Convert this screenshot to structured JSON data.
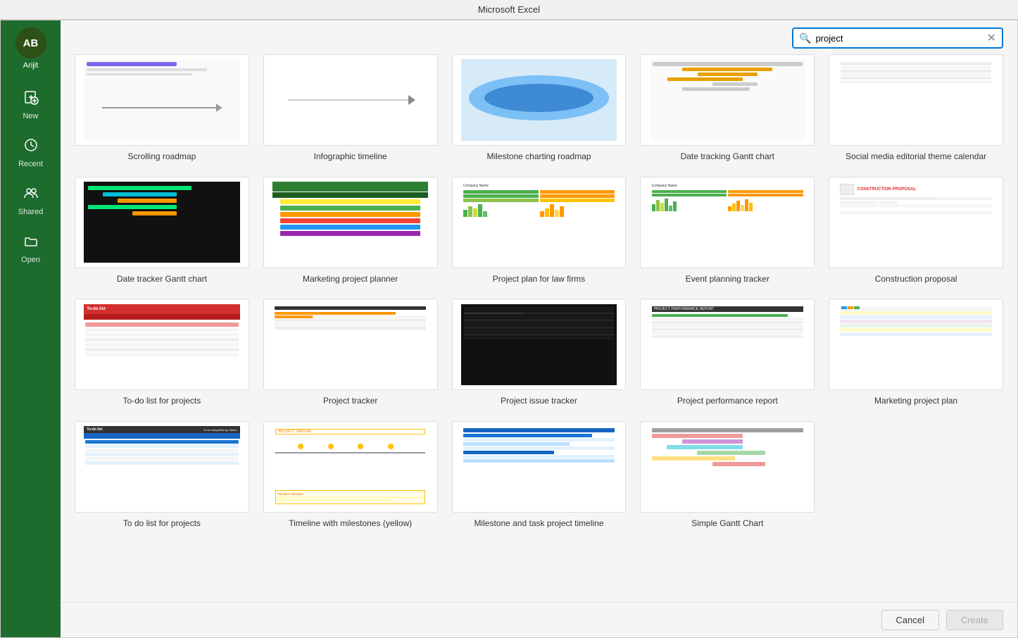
{
  "titleBar": {
    "title": "Microsoft Excel"
  },
  "search": {
    "placeholder": "Search",
    "value": "project"
  },
  "sidebar": {
    "avatar": "AB",
    "username": "Arijit",
    "items": [
      {
        "id": "new",
        "label": "New",
        "icon": "+"
      },
      {
        "id": "recent",
        "label": "Recent",
        "icon": "⏱"
      },
      {
        "id": "shared",
        "label": "Shared",
        "icon": "👥"
      },
      {
        "id": "open",
        "label": "Open",
        "icon": "📁"
      }
    ]
  },
  "templates": {
    "rows": [
      {
        "items": [
          {
            "id": "scrolling-roadmap",
            "label": "Scrolling roadmap",
            "type": "scrolling-roadmap"
          },
          {
            "id": "infographic-timeline",
            "label": "Infographic timeline",
            "type": "infographic"
          },
          {
            "id": "milestone-charting-roadmap",
            "label": "Milestone charting roadmap",
            "type": "milestone"
          },
          {
            "id": "date-tracking-gantt",
            "label": "Date tracking Gantt chart",
            "type": "date-gantt"
          },
          {
            "id": "social-media-editorial",
            "label": "Social media editorial theme calendar",
            "type": "social"
          }
        ]
      },
      {
        "items": [
          {
            "id": "date-tracker-gantt",
            "label": "Date tracker Gantt chart",
            "type": "dark-gantt"
          },
          {
            "id": "marketing-project-planner",
            "label": "Marketing project planner",
            "type": "marketing-planner"
          },
          {
            "id": "project-plan-law",
            "label": "Project plan for law firms",
            "type": "law-plan"
          },
          {
            "id": "event-planning-tracker",
            "label": "Event planning tracker",
            "type": "event-tracker"
          },
          {
            "id": "construction-proposal",
            "label": "Construction proposal",
            "type": "construction"
          }
        ]
      },
      {
        "items": [
          {
            "id": "todo-list-projects",
            "label": "To-do list for projects",
            "type": "todo-list"
          },
          {
            "id": "project-tracker",
            "label": "Project tracker",
            "type": "proj-tracker"
          },
          {
            "id": "project-issue-tracker",
            "label": "Project issue tracker",
            "type": "issue-tracker"
          },
          {
            "id": "project-performance-report",
            "label": "Project performance report",
            "type": "perf-report"
          },
          {
            "id": "marketing-project-plan",
            "label": "Marketing project plan",
            "type": "mkt-plan"
          }
        ]
      },
      {
        "items": [
          {
            "id": "todo-list-projects-2",
            "label": "To do list for projects",
            "type": "todo-list-2"
          },
          {
            "id": "timeline-milestones-yellow",
            "label": "Timeline with milestones (yellow)",
            "type": "timeline-yellow"
          },
          {
            "id": "milestone-task-timeline",
            "label": "Milestone and task project timeline",
            "type": "milestone-task"
          },
          {
            "id": "simple-gantt",
            "label": "Simple Gantt Chart",
            "type": "simple-gantt"
          }
        ]
      }
    ]
  },
  "buttons": {
    "cancel": "Cancel",
    "create": "Create"
  }
}
